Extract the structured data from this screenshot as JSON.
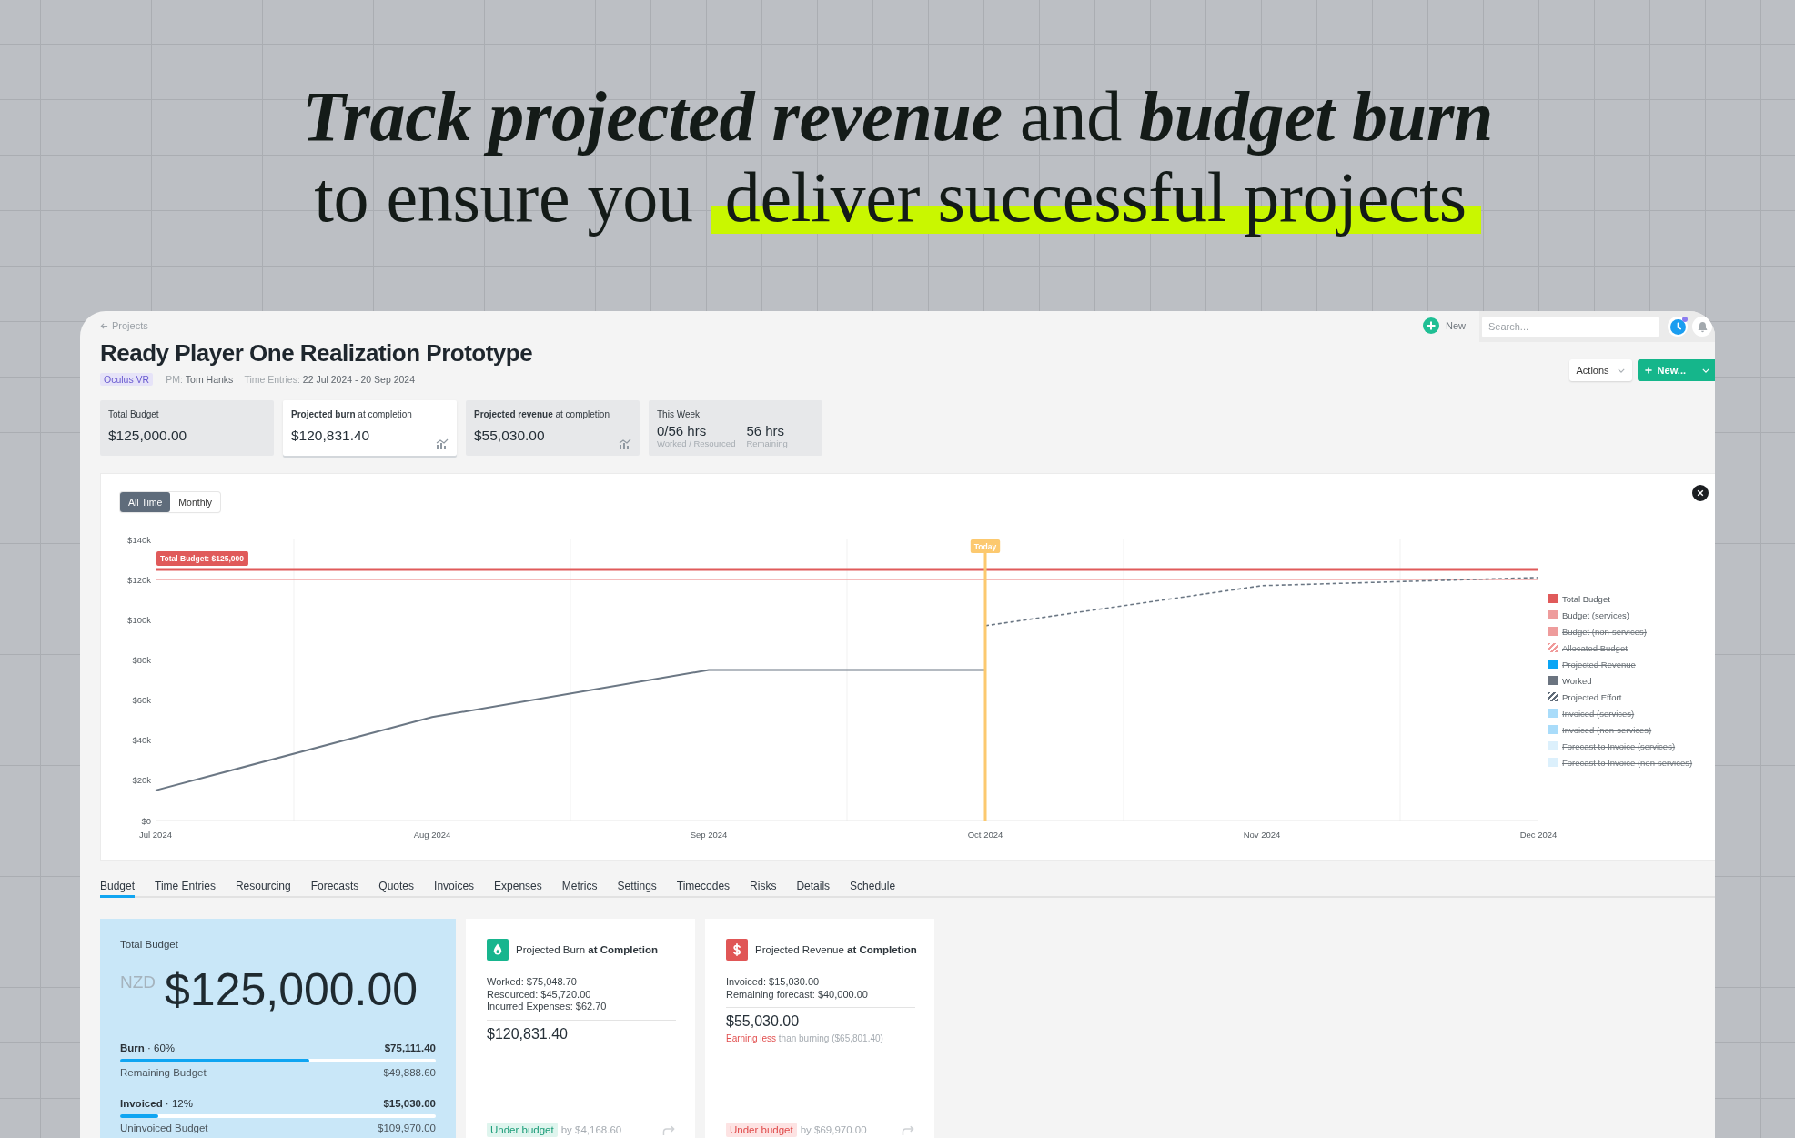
{
  "headline": {
    "text": "*Track projected revenue* and *budget burn*",
    "line_2": "to ensure you",
    "highlight": "deliver successful projects"
  },
  "header": {
    "back_link": "Projects",
    "new_button": "New",
    "search": {
      "placeholder": "Search..."
    },
    "timer_notification": true,
    "title": "Ready Player One Realization Prototype",
    "client_tag": "Oculus VR",
    "pm": {
      "label": "PM:",
      "value": "Tom Hanks"
    },
    "time_entries": {
      "label": "Time Entries:",
      "value": "22 Jul 2024 - 20 Sep 2024"
    },
    "actions_button": "Actions",
    "create_button": "New..."
  },
  "stats": [
    {
      "kind": "single",
      "label": "Total Budget",
      "value": "$125,000.00",
      "selected": false,
      "chart_icon": false
    },
    {
      "kind": "single",
      "label": "**Projected burn** at completion",
      "value": "$120,831.40",
      "selected": true,
      "chart_icon": true
    },
    {
      "kind": "single",
      "label": "**Projected revenue** at completion",
      "value": "$55,030.00",
      "selected": false,
      "chart_icon": true
    },
    {
      "kind": "split",
      "label": "This Week",
      "parts": [
        {
          "value": "0/56 hrs",
          "caption": "Worked / Resourced"
        },
        {
          "value": "56 hrs",
          "caption": "Remaining"
        }
      ],
      "selected": false,
      "chart_icon": false
    }
  ],
  "chart": {
    "range_toggle": [
      {
        "label": "All Time",
        "selected": true
      },
      {
        "label": "Monthly",
        "selected": false
      }
    ],
    "chart_data": {
      "type": "line",
      "categories": [
        "Jul 2024",
        "Aug 2024",
        "Sep 2024",
        "Oct 2024",
        "Nov 2024",
        "Dec 2024"
      ],
      "ylim": [
        0,
        140000
      ],
      "yticks": [
        {
          "value": 0,
          "label": "$0"
        },
        {
          "value": 20000,
          "label": "$20k"
        },
        {
          "value": 40000,
          "label": "$40k"
        },
        {
          "value": 60000,
          "label": "$60k"
        },
        {
          "value": 80000,
          "label": "$80k"
        },
        {
          "value": 100000,
          "label": "$100k"
        },
        {
          "value": 120000,
          "label": "$120k"
        },
        {
          "value": 140000,
          "label": "$140k"
        }
      ],
      "series": [
        {
          "color": "#e05a5a",
          "line_style": "solid",
          "values": [
            125000,
            125000,
            125000,
            125000,
            125000,
            125000
          ]
        },
        {
          "color": "#f2a6a6",
          "line_style": "solid",
          "values": [
            120000,
            120000,
            120000,
            120000,
            120000,
            120000
          ]
        },
        {
          "color": "#6b7784",
          "line_style": "solid",
          "values": [
            15000,
            51500,
            75000,
            75000,
            null,
            null
          ]
        },
        {
          "color": "#6b7784",
          "line_style": "dashed",
          "values": [
            null,
            null,
            null,
            97000,
            117000,
            121000
          ]
        }
      ],
      "annotations": [
        {
          "x": "Jul 2024",
          "y": 125000,
          "text": "Total Budget: $125,000"
        }
      ],
      "ref_lines": [
        {
          "axis": "x",
          "value": "Oct 2024",
          "label": "Today",
          "color": "#fcc96f"
        }
      ]
    },
    "legend": [
      {
        "label": "Total Budget",
        "color": "#e05a5a",
        "kind": "solid",
        "hidden": false
      },
      {
        "label": "Budget (services)",
        "color": "#ee9c9c",
        "kind": "solid",
        "hidden": false
      },
      {
        "label": "Budget (non-services)",
        "color": "#ee9c9c",
        "kind": "solid",
        "hidden": true
      },
      {
        "label": "Allocated Budget",
        "color": "#f09a9a",
        "kind": "hatched",
        "hidden": true
      },
      {
        "label": "Projected Revenue",
        "color": "#0aa5f5",
        "kind": "solid",
        "hidden": true
      },
      {
        "label": "Worked",
        "color": "#6b7480",
        "kind": "solid",
        "hidden": false
      },
      {
        "label": "Projected Effort",
        "color": "#5f6b78",
        "kind": "hatched",
        "hidden": false
      },
      {
        "label": "Invoiced (services)",
        "color": "#a9dcfa",
        "kind": "solid",
        "hidden": true
      },
      {
        "label": "Invoiced (non-services)",
        "color": "#a9dcfa",
        "kind": "solid",
        "hidden": true
      },
      {
        "label": "Forecast to Invoice (services)",
        "color": "#dcf0fc",
        "kind": "solid",
        "hidden": true
      },
      {
        "label": "Forecast to Invoice (non-services)",
        "color": "#dcf0fc",
        "kind": "solid",
        "hidden": true
      }
    ]
  },
  "tabs": [
    {
      "label": "Budget",
      "selected": true
    },
    {
      "label": "Time Entries",
      "selected": false
    },
    {
      "label": "Resourcing",
      "selected": false
    },
    {
      "label": "Forecasts",
      "selected": false
    },
    {
      "label": "Quotes",
      "selected": false
    },
    {
      "label": "Invoices",
      "selected": false
    },
    {
      "label": "Expenses",
      "selected": false
    },
    {
      "label": "Metrics",
      "selected": false
    },
    {
      "label": "Settings",
      "selected": false
    },
    {
      "label": "Timecodes",
      "selected": false
    },
    {
      "label": "Risks",
      "selected": false
    },
    {
      "label": "Details",
      "selected": false
    },
    {
      "label": "Schedule",
      "selected": false
    }
  ],
  "budget_card": {
    "label": "Total Budget",
    "currency": "NZD",
    "amount": "$125,000.00",
    "meters": [
      {
        "label": "**Burn** · 60%",
        "amount": "$75,111.40",
        "level": 0.6,
        "remainder_label": "Remaining Budget",
        "remainder_amount": "$49,888.60"
      },
      {
        "label": "**Invoiced** · 12%",
        "amount": "$15,030.00",
        "level": 0.12,
        "remainder_label": "Uninvoiced Budget",
        "remainder_amount": "$109,970.00"
      }
    ]
  },
  "summary_cards": [
    {
      "kind": "burn",
      "title": "Projected Burn **at Completion**",
      "lines": [
        "Worked: $75,048.70",
        "Resourced: $45,720.00",
        "Incurred Expenses: $62.70"
      ],
      "total": "$120,831.40",
      "status": {
        "label": "Under budget",
        "kind": "positive"
      },
      "delta": "by $4,168.60"
    },
    {
      "kind": "revenue",
      "title": "Projected Revenue **at Completion**",
      "lines": [
        "Invoiced: $15,030.00",
        "Remaining forecast: $40,000.00"
      ],
      "total": "$55,030.00",
      "note": "**Earning less** than burning ($65,801.40)",
      "status": {
        "label": "Under budget",
        "kind": "negative"
      },
      "delta": "by $69,970.00"
    }
  ]
}
